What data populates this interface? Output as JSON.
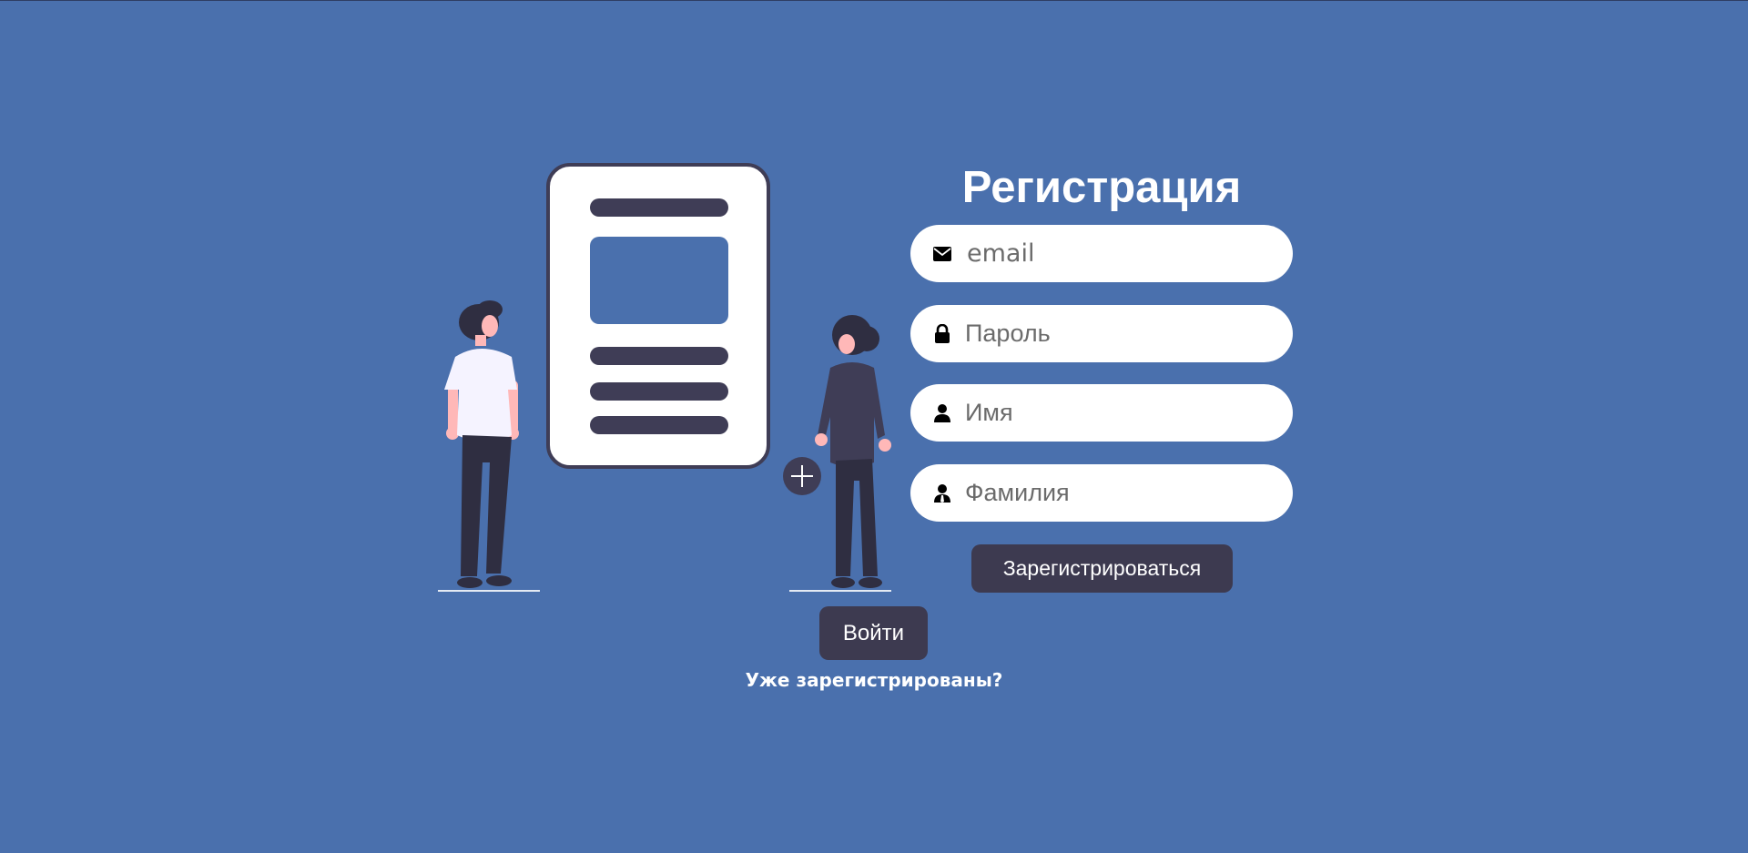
{
  "colors": {
    "background": "#4a70ad",
    "button": "#3d3a50",
    "field_background": "#ffffff",
    "text_on_dark": "#ffffff"
  },
  "register": {
    "title": "Регистрация",
    "fields": {
      "email": {
        "placeholder": "email",
        "icon": "envelope-icon",
        "value": ""
      },
      "password": {
        "placeholder": "Пароль",
        "icon": "lock-icon",
        "value": ""
      },
      "first_name": {
        "placeholder": "Имя",
        "icon": "user-icon",
        "value": ""
      },
      "last_name": {
        "placeholder": "Фамилия",
        "icon": "user-tie-icon",
        "value": ""
      }
    },
    "submit_label": "Зарегистрироваться"
  },
  "login": {
    "button_label": "Войти",
    "prompt": "Уже зарегистрированы?"
  }
}
